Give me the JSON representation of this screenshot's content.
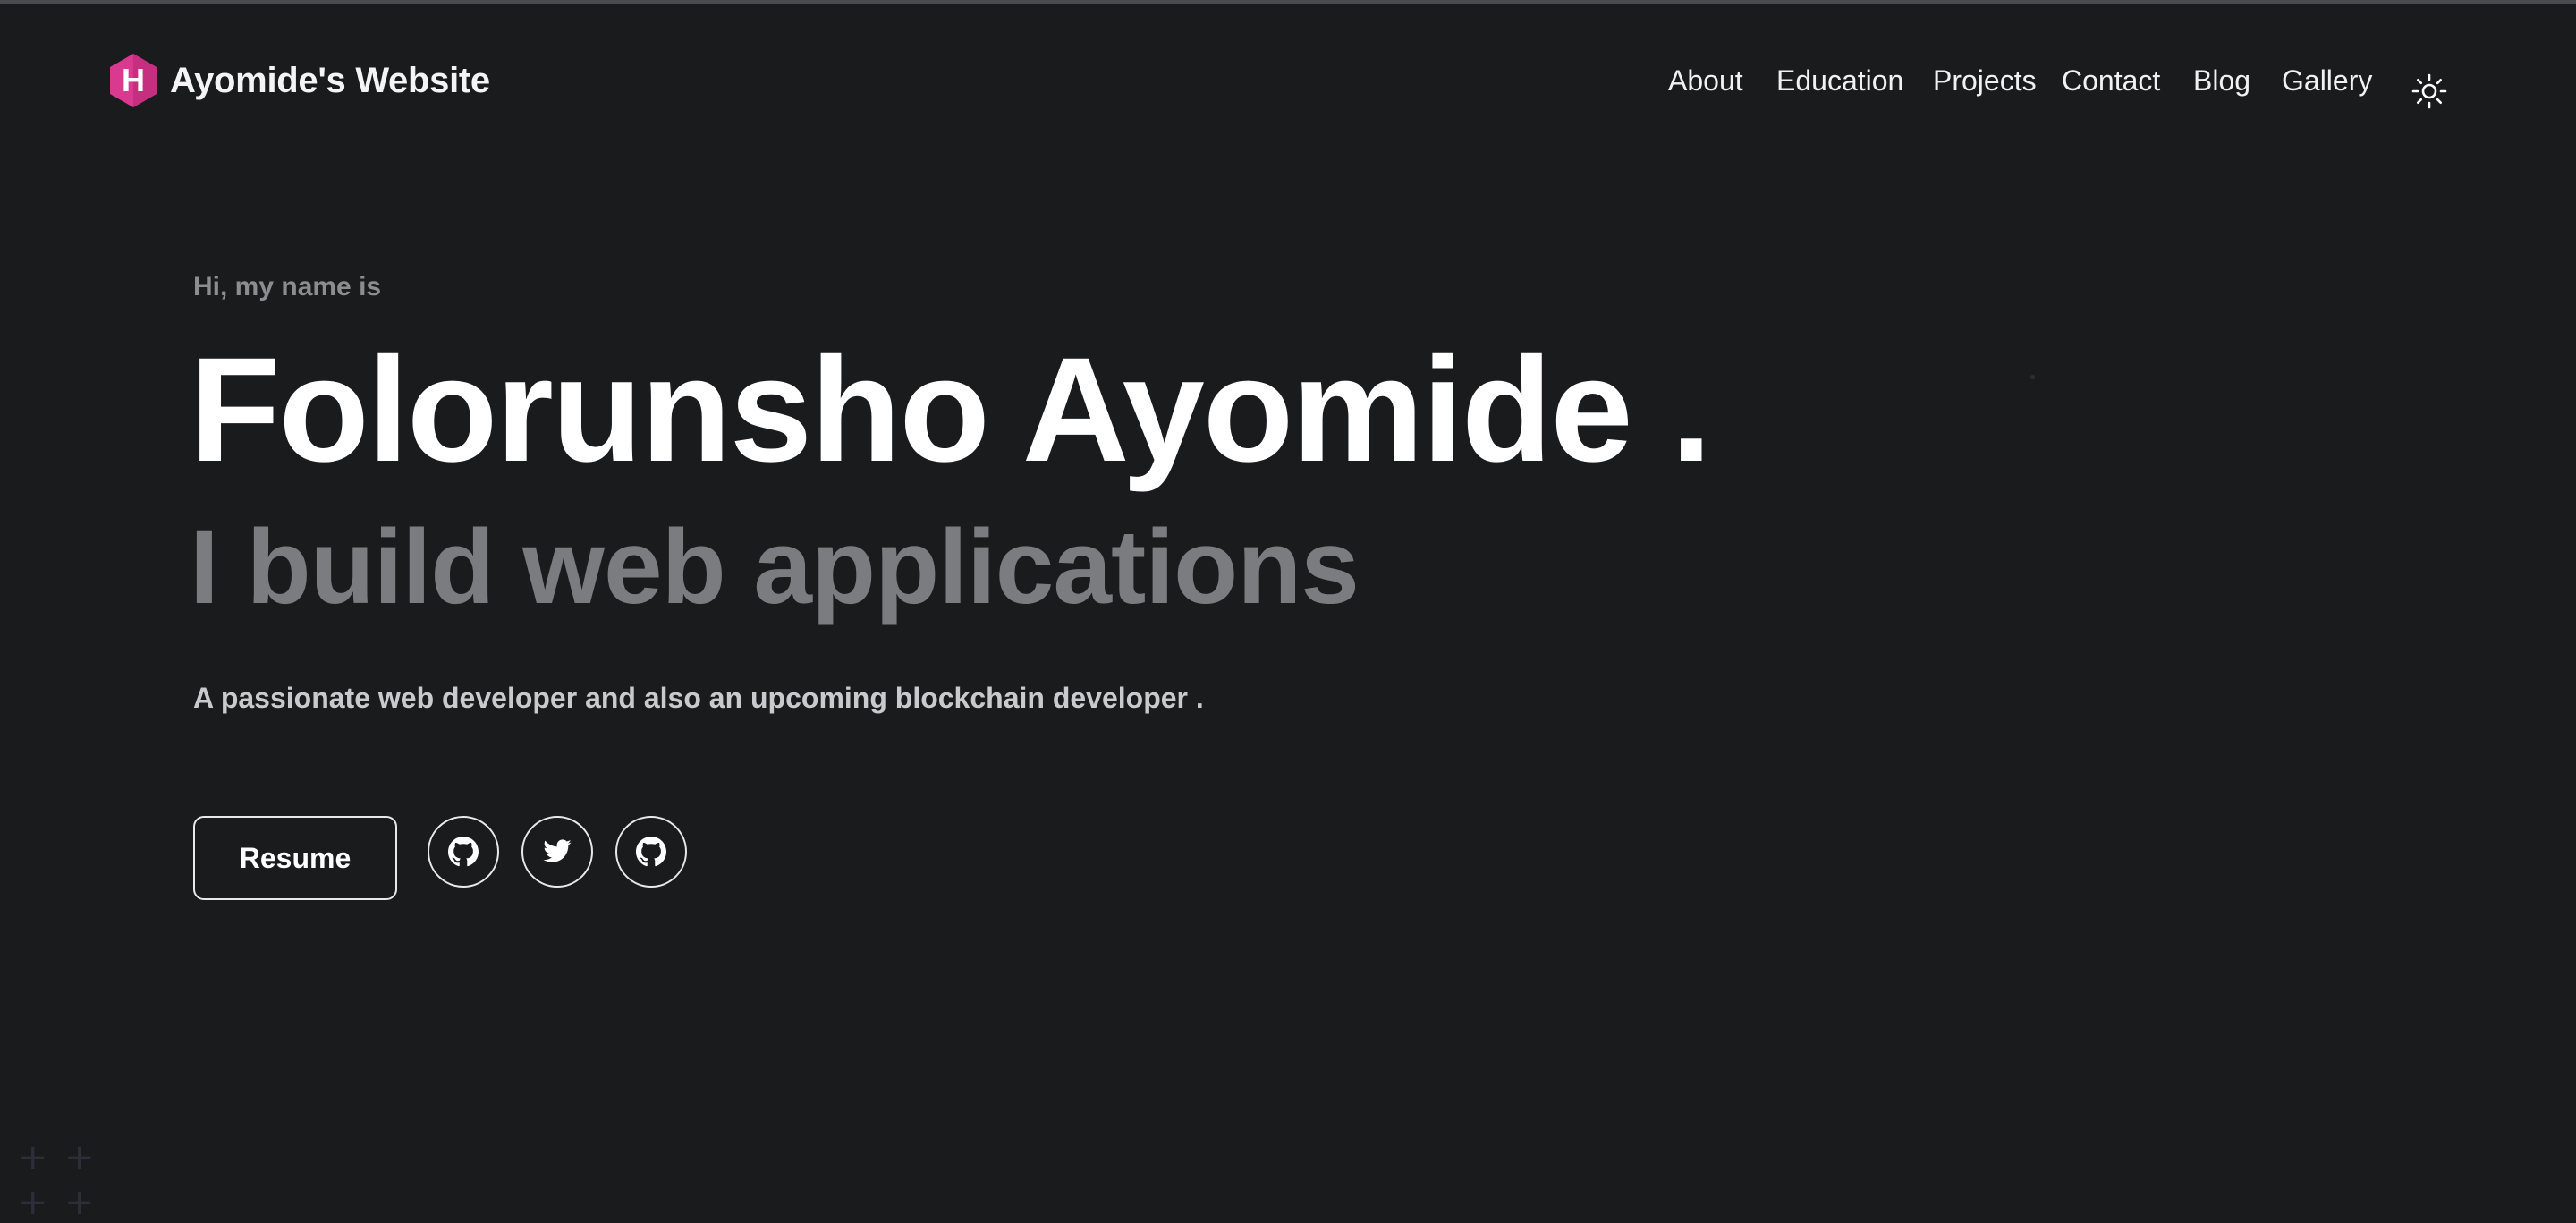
{
  "header": {
    "logo_letter": "H",
    "site_title": "Ayomide's Website",
    "nav": [
      {
        "label": "About"
      },
      {
        "label": "Education"
      },
      {
        "label": "Projects"
      },
      {
        "label": "Contact"
      },
      {
        "label": "Blog"
      },
      {
        "label": "Gallery"
      }
    ],
    "theme_toggle_icon": "sun-icon"
  },
  "hero": {
    "greeting": "Hi, my name is",
    "name": "Folorunsho Ayomide .",
    "tagline": "I build web applications",
    "description": "A passionate web developer and also an upcoming blockchain developer .",
    "resume_label": "Resume",
    "socials": [
      {
        "icon": "github-icon"
      },
      {
        "icon": "twitter-icon"
      },
      {
        "icon": "github-icon"
      }
    ]
  },
  "colors": {
    "background": "#1a1b1d",
    "logo_pink": "#d9398f",
    "text_primary": "#ffffff",
    "text_muted": "#7b7c80"
  }
}
